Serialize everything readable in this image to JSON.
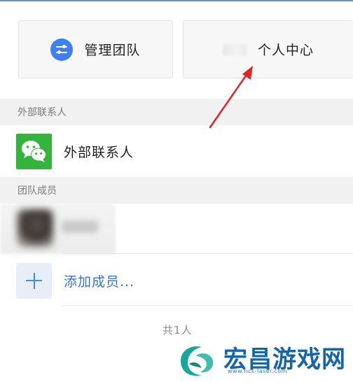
{
  "actions": {
    "manage_team_label": "管理团队",
    "profile_label": "个人中心"
  },
  "sections": {
    "external_contacts_header": "外部联系人",
    "team_members_header": "团队成员"
  },
  "rows": {
    "external_contacts_label": "外部联系人",
    "add_member_label": "添加成员..."
  },
  "footer": {
    "member_count": "共1人"
  },
  "watermark": {
    "brand": "宏昌游戏网",
    "url": "www.hcs-laser.com"
  },
  "icons": {
    "manage": "sliders-icon",
    "wechat": "wechat-icon",
    "add": "plus-icon",
    "annotation": "red-arrow-icon"
  },
  "colors": {
    "accent_blue": "#3e7ff1",
    "wechat_green": "#34b43d",
    "link_blue": "#3672cc",
    "annotation_red": "#e02424",
    "watermark_blue": "#1565a8"
  }
}
